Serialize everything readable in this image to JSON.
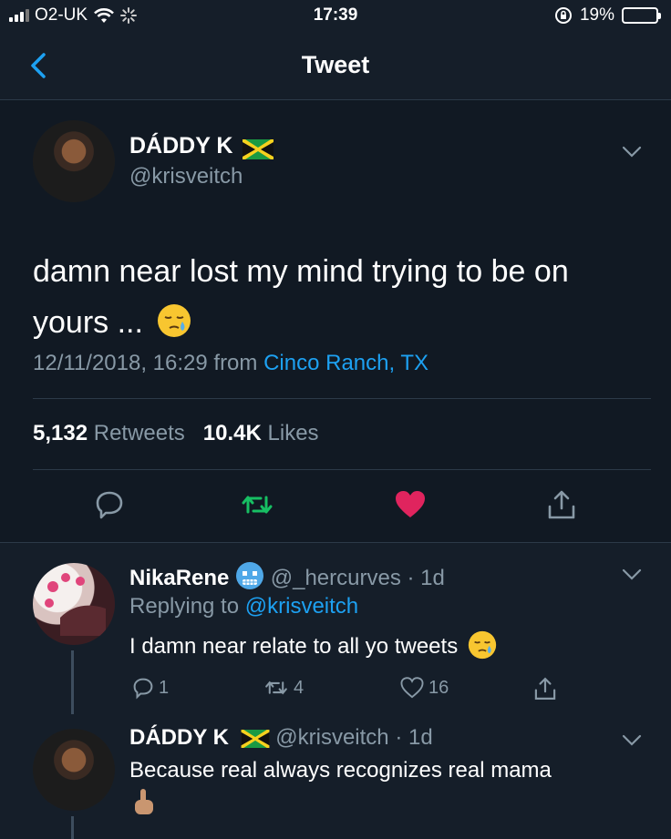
{
  "status_bar": {
    "carrier": "O2-UK",
    "time": "17:39",
    "battery": "19%",
    "battery_level": 0.19
  },
  "nav": {
    "title": "Tweet"
  },
  "main_tweet": {
    "display_name": "DÁDDY K",
    "handle": "@krisveitch",
    "text": "damn near lost my mind trying to be on yours ...",
    "timestamp": "12/11/2018, 16:29 from ",
    "location": "Cinco Ranch, TX",
    "retweets_count": "5,132",
    "retweets_label": "Retweets",
    "likes_count": "10.4K",
    "likes_label": "Likes"
  },
  "replies": [
    {
      "display_name": "NikaRene",
      "handle": "@_hercurves",
      "age": "· 1d",
      "replying_prefix": "Replying to ",
      "replying_to": "@krisveitch",
      "text": "I damn near relate to all yo tweets",
      "reply_count": "1",
      "retweet_count": "4",
      "like_count": "16"
    },
    {
      "display_name": "DÁDDY K",
      "handle": "@krisveitch",
      "age": "· 1d",
      "text": "Because real always recognizes real mama"
    }
  ],
  "colors": {
    "accent": "#1da1f2",
    "retweet": "#17bf63",
    "like": "#e0245e",
    "muted": "#8899a6",
    "background": "#151e29"
  }
}
